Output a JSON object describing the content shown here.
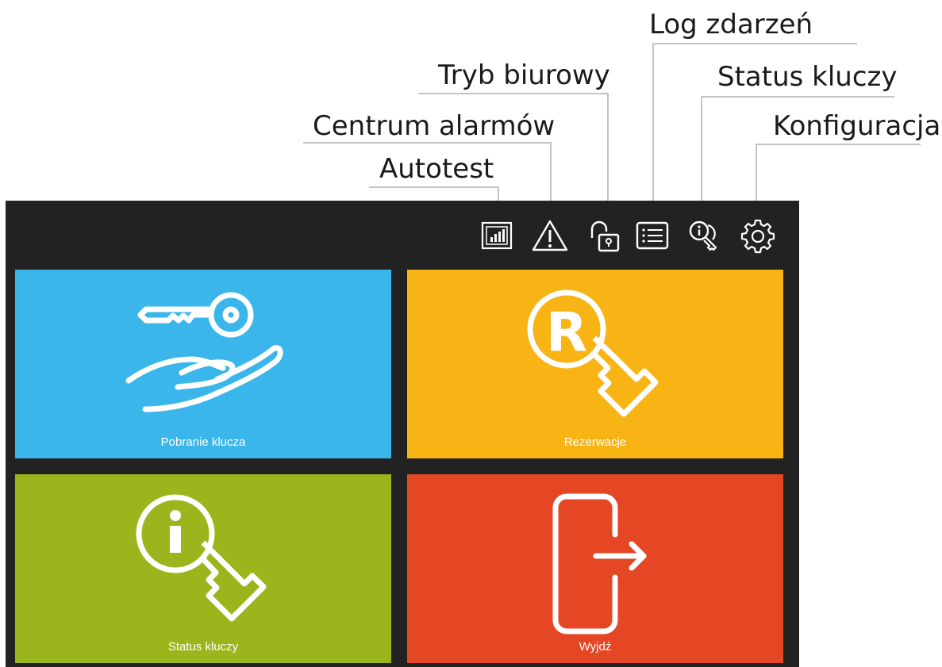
{
  "callouts": {
    "log_zdarzen": "Log zdarzeń",
    "tryb_biurowy": "Tryb biurowy",
    "status_kluczy": "Status kluczy",
    "centrum_alarmow": "Centrum alarmów",
    "konfiguracja": "Konfiguracja",
    "autotest": "Autotest"
  },
  "toolbar": {
    "icons": [
      "autotest-icon",
      "alarm-warning-icon",
      "office-mode-unlock-icon",
      "event-log-list-icon",
      "key-status-icon",
      "settings-gear-icon"
    ]
  },
  "tiles": {
    "pobranie": {
      "label": "Pobranie klucza",
      "color": "#3bb6ea",
      "icon": "hand-key-icon"
    },
    "rezerwacje": {
      "label": "Rezerwacje",
      "color": "#f7b414",
      "icon": "reservation-key-icon"
    },
    "status": {
      "label": "Status kluczy",
      "color": "#9bb51d",
      "icon": "info-key-icon"
    },
    "wyjdz": {
      "label": "Wyjdź",
      "color": "#e54624",
      "icon": "exit-door-icon"
    }
  },
  "colors": {
    "panel": "#222222",
    "leader_line": "#b0b0b0"
  }
}
